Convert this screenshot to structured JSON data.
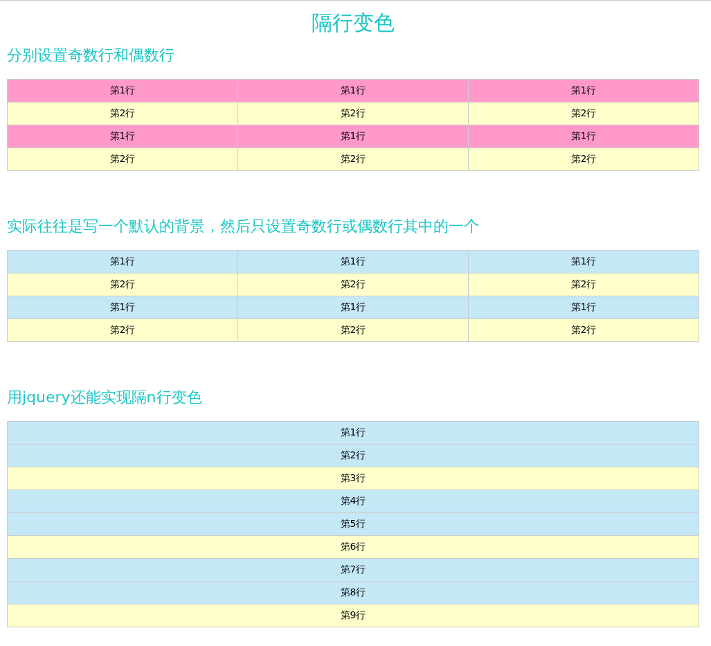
{
  "title": "隔行变色",
  "sections": [
    {
      "heading": "分别设置奇数行和偶数行",
      "rows": [
        {
          "color": "#ff99cc",
          "cells": [
            "第1行",
            "第1行",
            "第1行"
          ]
        },
        {
          "color": "#ffffcc",
          "cells": [
            "第2行",
            "第2行",
            "第2行"
          ]
        },
        {
          "color": "#ff99cc",
          "cells": [
            "第1行",
            "第1行",
            "第1行"
          ]
        },
        {
          "color": "#ffffcc",
          "cells": [
            "第2行",
            "第2行",
            "第2行"
          ]
        }
      ]
    },
    {
      "heading": "实际往往是写一个默认的背景，然后只设置奇数行或偶数行其中的一个",
      "rows": [
        {
          "color": "#c5e8f7",
          "cells": [
            "第1行",
            "第1行",
            "第1行"
          ]
        },
        {
          "color": "#ffffcc",
          "cells": [
            "第2行",
            "第2行",
            "第2行"
          ]
        },
        {
          "color": "#c5e8f7",
          "cells": [
            "第1行",
            "第1行",
            "第1行"
          ]
        },
        {
          "color": "#ffffcc",
          "cells": [
            "第2行",
            "第2行",
            "第2行"
          ]
        }
      ]
    },
    {
      "heading": "用jquery还能实现隔n行变色",
      "rows": [
        {
          "color": "#c5e8f7",
          "cells": [
            "第1行"
          ]
        },
        {
          "color": "#c5e8f7",
          "cells": [
            "第2行"
          ]
        },
        {
          "color": "#ffffcc",
          "cells": [
            "第3行"
          ]
        },
        {
          "color": "#c5e8f7",
          "cells": [
            "第4行"
          ]
        },
        {
          "color": "#c5e8f7",
          "cells": [
            "第5行"
          ]
        },
        {
          "color": "#ffffcc",
          "cells": [
            "第6行"
          ]
        },
        {
          "color": "#c5e8f7",
          "cells": [
            "第7行"
          ]
        },
        {
          "color": "#c5e8f7",
          "cells": [
            "第8行"
          ]
        },
        {
          "color": "#ffffcc",
          "cells": [
            "第9行"
          ]
        }
      ]
    }
  ]
}
